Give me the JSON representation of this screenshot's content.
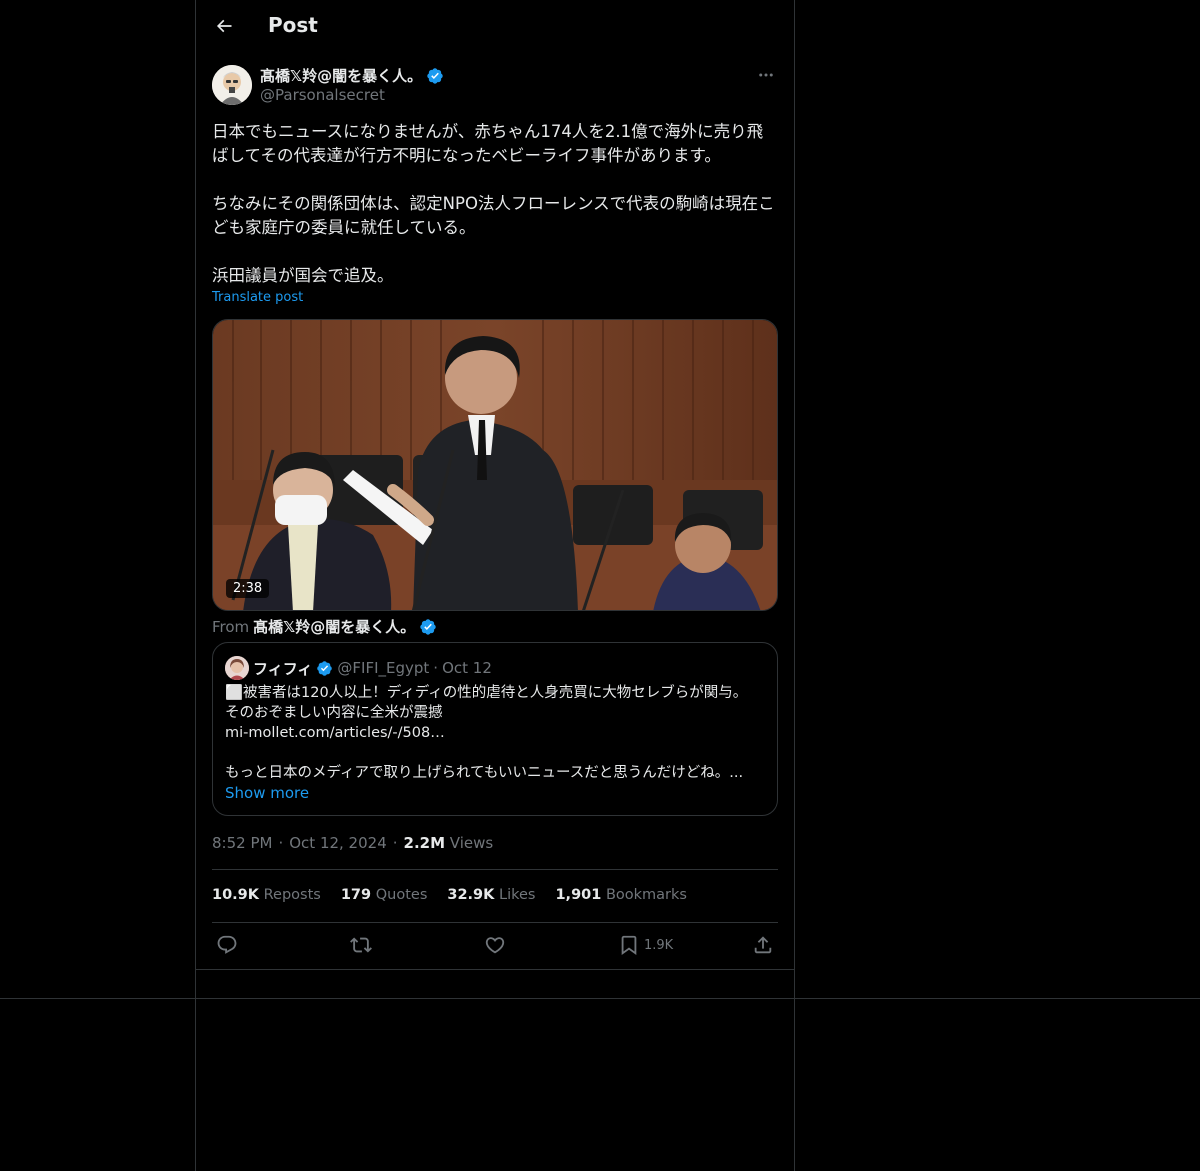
{
  "header": {
    "title": "Post"
  },
  "author": {
    "name": "髙橋𝕏羚@闇を暴く人。",
    "handle": "@Parsonalsecret"
  },
  "post": {
    "paragraphs": [
      "日本でもニュースになりませんが、赤ちゃん174人を2.1億で海外に売り飛ばしてその代表達が行方不明になったベビーライフ事件があります。",
      "ちなみにその関係団体は、認定NPO法人フローレンスで代表の駒崎は現在こども家庭庁の委員に就任している。",
      "浜田議員が国会で追及。"
    ],
    "translate_label": "Translate post"
  },
  "media": {
    "duration": "2:38",
    "from_label": "From",
    "from_name": "髙橋𝕏羚@闇を暴く人。"
  },
  "quote": {
    "name": "フィフィ",
    "handle": "@FIFI_Egypt",
    "separator": "·",
    "date": "Oct 12",
    "lines": [
      "⬜被害者は120人以上！ディディの性的虐待と人身売買に大物セレブらが関与。",
      "そのおぞましい内容に全米が震撼",
      "mi-mollet.com/articles/-/508…",
      "",
      "もっと日本のメディアで取り上げられてもいいニュースだと思うんだけどね。..."
    ],
    "show_more": "Show more"
  },
  "meta": {
    "time": "8:52 PM",
    "separator": "·",
    "date": "Oct 12, 2024",
    "views_count": "2.2M",
    "views_label": "Views"
  },
  "stats": [
    {
      "count": "10.9K",
      "label": "Reposts"
    },
    {
      "count": "179",
      "label": "Quotes"
    },
    {
      "count": "32.9K",
      "label": "Likes"
    },
    {
      "count": "1,901",
      "label": "Bookmarks"
    }
  ],
  "actions": {
    "bookmark_count": "1.9K"
  },
  "colors": {
    "background": "#000000",
    "text": "#e7e9ea",
    "muted": "#71767b",
    "accent": "#1d9bf0",
    "border": "#2f3336"
  }
}
